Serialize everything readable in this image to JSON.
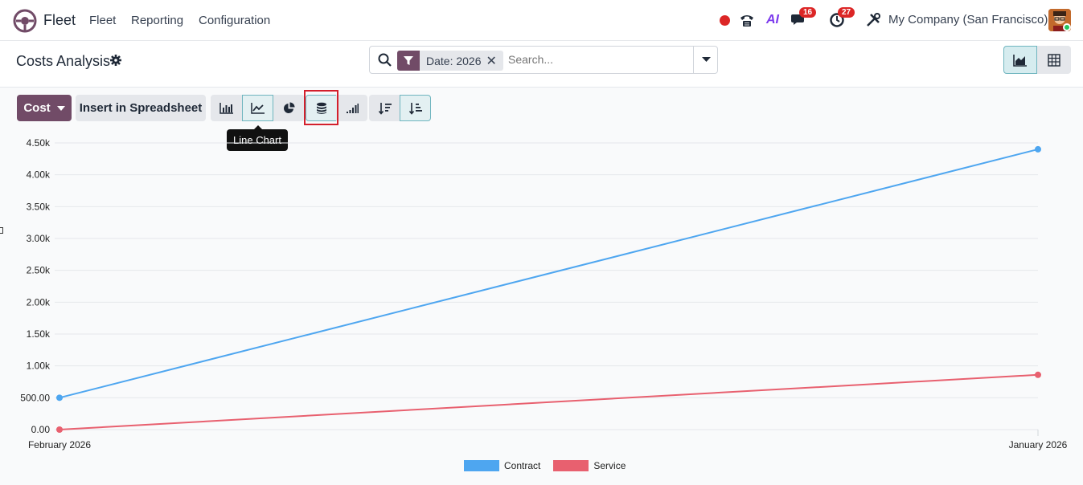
{
  "navbar": {
    "app_name": "Fleet",
    "menu": [
      "Fleet",
      "Reporting",
      "Configuration"
    ],
    "messages_count": "16",
    "activities_count": "27",
    "ai_label": "AI",
    "company": "My Company (San Francisco)"
  },
  "control_panel": {
    "title": "Costs Analysis",
    "facet_label": "Date: 2026",
    "search_placeholder": "Search..."
  },
  "toolbar": {
    "measure_label": "Cost",
    "spreadsheet_label": "Insert in Spreadsheet",
    "tooltip": "Line Chart"
  },
  "chart_data": {
    "type": "line",
    "x": [
      "February 2026",
      "January 2026"
    ],
    "series": [
      {
        "name": "Contract",
        "values": [
          500,
          4400
        ],
        "color": "#4ea6f0"
      },
      {
        "name": "Service",
        "values": [
          0,
          860
        ],
        "color": "#e8606f"
      }
    ],
    "y_ticks": [
      "0.00",
      "500.00",
      "1.00k",
      "1.50k",
      "2.00k",
      "2.50k",
      "3.00k",
      "3.50k",
      "4.00k",
      "4.50k"
    ],
    "ylim": [
      0,
      4500
    ],
    "grid": true,
    "legend": "bottom"
  }
}
